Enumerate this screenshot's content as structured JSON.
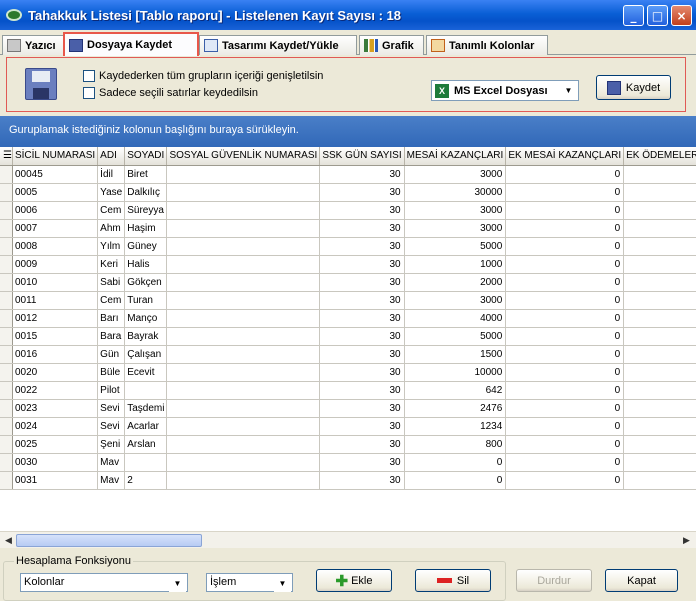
{
  "window": {
    "title": "Tahakkuk Listesi [Tablo raporu]  -  Listelenen Kayıt Sayısı : 18",
    "minimize": "_",
    "maximize": "□",
    "close": "×"
  },
  "tabs": [
    {
      "label": "Yazıcı"
    },
    {
      "label": "Dosyaya Kaydet"
    },
    {
      "label": "Tasarımı Kaydet/Yükle"
    },
    {
      "label": "Grafik"
    },
    {
      "label": "Tanımlı Kolonlar"
    }
  ],
  "export": {
    "option1": "Kaydederken tüm grupların içeriği genişletilsin",
    "option2": "Sadece seçili satırlar keydedilsin",
    "format": "MS Excel Dosyası",
    "format_icon": "X",
    "save": "Kaydet"
  },
  "group_hint": "Guruplamak istediğiniz kolonun başlığını buraya sürükleyin.",
  "columns": [
    "SİCİL NUMARASI",
    "ADI",
    "SOYADI",
    "SOSYAL GÜVENLİK NUMARASI",
    "SSK GÜN SAYISI",
    "MESAİ KAZANÇLARI",
    "EK MESAİ KAZANÇLARI",
    "EK ÖDEMELER"
  ],
  "rows": [
    [
      "00045",
      "İdil",
      "Biret",
      "",
      "30",
      "3000",
      "0"
    ],
    [
      "0005",
      "Yase",
      "Dalkılıç",
      "",
      "30",
      "30000",
      "0"
    ],
    [
      "0006",
      "Cem",
      "Süreyya",
      "",
      "30",
      "3000",
      "0"
    ],
    [
      "0007",
      "Ahm",
      "Haşim",
      "",
      "30",
      "3000",
      "0"
    ],
    [
      "0008",
      "Yılm",
      "Güney",
      "",
      "30",
      "5000",
      "0"
    ],
    [
      "0009",
      "Keri",
      "Halis",
      "",
      "30",
      "1000",
      "0"
    ],
    [
      "0010",
      "Sabi",
      "Gökçen",
      "",
      "30",
      "2000",
      "0"
    ],
    [
      "0011",
      "Cem",
      "Turan",
      "",
      "30",
      "3000",
      "0"
    ],
    [
      "0012",
      "Barı",
      "Manço",
      "",
      "30",
      "4000",
      "0"
    ],
    [
      "0015",
      "Bara",
      "Bayrak",
      "",
      "30",
      "5000",
      "0"
    ],
    [
      "0016",
      "Gün",
      "Çalışan",
      "",
      "30",
      "1500",
      "0"
    ],
    [
      "0020",
      "Büle",
      "Ecevit",
      "",
      "30",
      "10000",
      "0"
    ],
    [
      "0022",
      "Pilot",
      "",
      "",
      "30",
      "642",
      "0"
    ],
    [
      "0023",
      "Sevi",
      "Taşdemi",
      "",
      "30",
      "2476",
      "0"
    ],
    [
      "0024",
      "Sevi",
      "Acarlar",
      "",
      "30",
      "1234",
      "0"
    ],
    [
      "0025",
      "Şeni",
      "Arslan",
      "",
      "30",
      "800",
      "0"
    ],
    [
      "0030",
      "Mav",
      "",
      "",
      "30",
      "0",
      "0"
    ],
    [
      "0031",
      "Mav",
      "2",
      "",
      "30",
      "0",
      "0"
    ]
  ],
  "footer": {
    "legend": "Hesaplama Fonksiyonu",
    "column_select": "Kolonlar",
    "op_select": "İşlem",
    "add": "Ekle",
    "delete": "Sil",
    "stop": "Durdur",
    "close": "Kapat"
  }
}
